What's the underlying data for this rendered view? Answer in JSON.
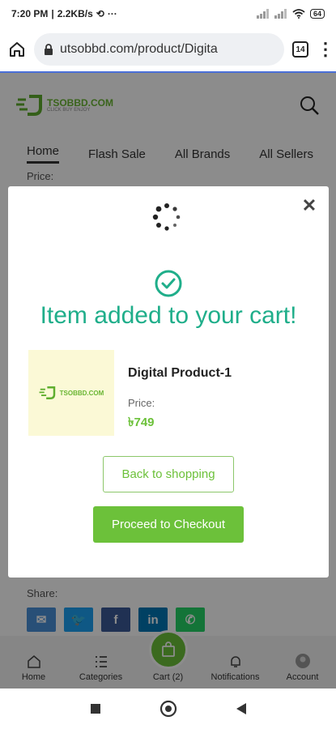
{
  "status_bar": {
    "time": "7:20 PM",
    "speed": "2.2KB/s",
    "extra": "···",
    "battery": "64"
  },
  "browser": {
    "url": "utsobbd.com/product/Digita",
    "tab_count": "14"
  },
  "site": {
    "logo_text": "TSOBBD.COM",
    "logo_tagline": "CLICK BUY ENJOY",
    "nav": [
      "Home",
      "Flash Sale",
      "All Brands",
      "All Sellers"
    ],
    "price_label_bg": "Price:",
    "share_label": "Share:"
  },
  "modal": {
    "title": "Item added to your cart!",
    "product_name": "Digital Product-1",
    "price_label": "Price:",
    "price": "৳749",
    "back_button": "Back to shopping",
    "checkout_button": "Proceed to Checkout",
    "close_icon": "close-icon"
  },
  "app_nav": {
    "items": [
      "Home",
      "Categories",
      "Cart (2)",
      "Notifications",
      "Account"
    ]
  },
  "colors": {
    "accent": "#6cc13a",
    "title_teal": "#1fae8a",
    "thumb_bg": "#fbf9d6"
  }
}
